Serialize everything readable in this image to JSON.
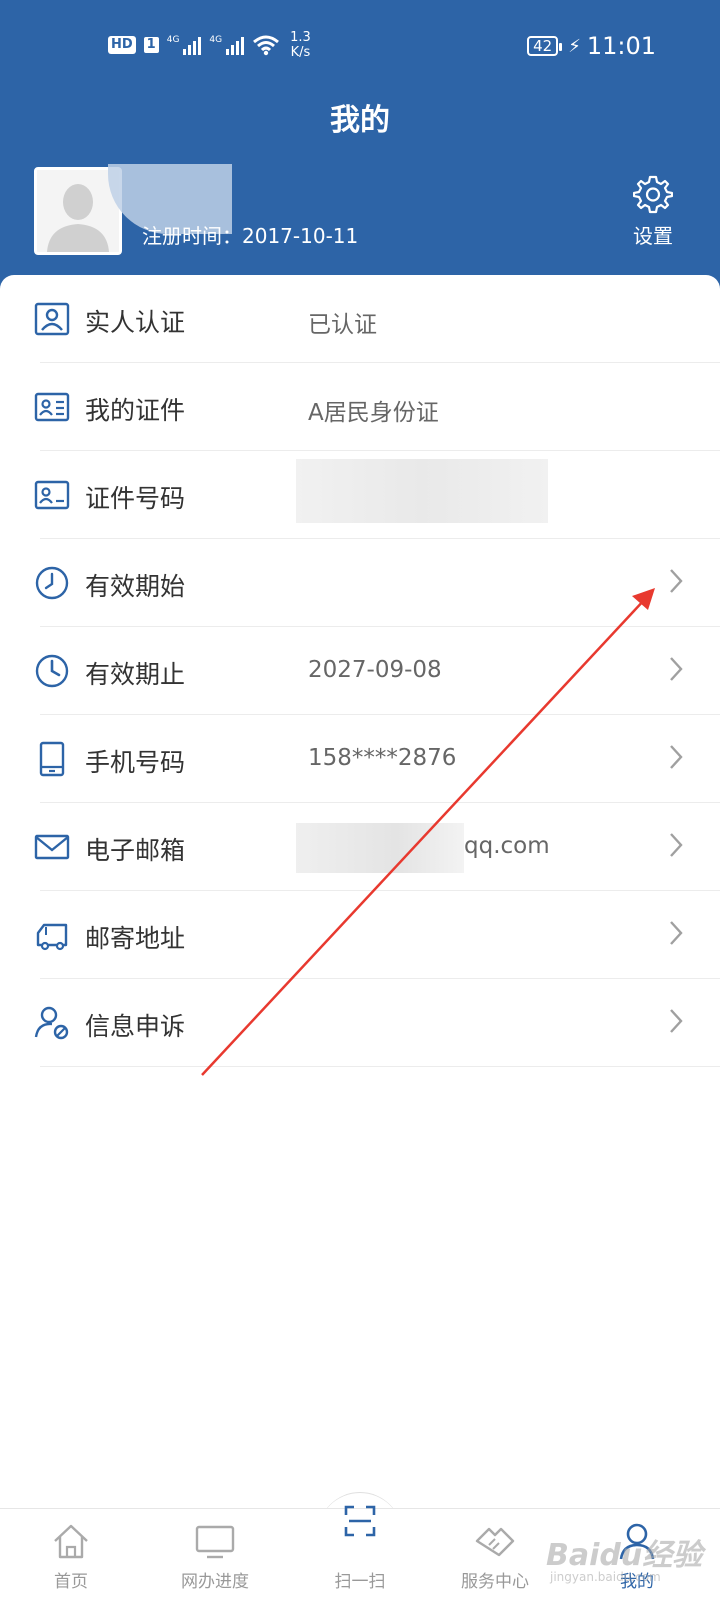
{
  "status_bar": {
    "hd": "HD",
    "sim": "1",
    "net1": "4G",
    "net2": "4G",
    "speed_value": "1.3",
    "speed_unit": "K/s",
    "battery": "42",
    "time": "11:01"
  },
  "header": {
    "title": "我的",
    "reg_time": "注册时间：2017-10-11",
    "settings_label": "设置"
  },
  "list": [
    {
      "label": "实人认证",
      "value": "已认证",
      "icon": "id-card-portrait-icon",
      "chevron": false
    },
    {
      "label": "我的证件",
      "value": "A居民身份证",
      "icon": "id-card-icon",
      "chevron": false
    },
    {
      "label": "证件号码",
      "value": "",
      "icon": "id-card-number-icon",
      "chevron": false
    },
    {
      "label": "有效期始",
      "value": "",
      "icon": "clock-outline-icon",
      "chevron": true
    },
    {
      "label": "有效期止",
      "value": "2027-09-08",
      "icon": "clock-filled-icon",
      "chevron": true
    },
    {
      "label": "手机号码",
      "value": "158****2876",
      "icon": "phone-icon",
      "chevron": true
    },
    {
      "label": "电子邮箱",
      "value": "qq.com",
      "icon": "mail-icon",
      "chevron": true
    },
    {
      "label": "邮寄地址",
      "value": "",
      "icon": "truck-icon",
      "chevron": true
    },
    {
      "label": "信息申诉",
      "value": "",
      "icon": "user-appeal-icon",
      "chevron": true
    }
  ],
  "bottom_nav": [
    {
      "label": "首页",
      "icon": "home-icon"
    },
    {
      "label": "网办进度",
      "icon": "monitor-icon"
    },
    {
      "label": "扫一扫",
      "icon": "scan-icon"
    },
    {
      "label": "服务中心",
      "icon": "handshake-icon"
    },
    {
      "label": "我的",
      "icon": "person-icon"
    }
  ],
  "watermark": {
    "main": "Baidu经验",
    "sub": "jingyan.baidu.com"
  },
  "colors": {
    "brand": "#2d64a7",
    "icon": "#2d64a7",
    "annotation_arrow": "#e8392f"
  }
}
